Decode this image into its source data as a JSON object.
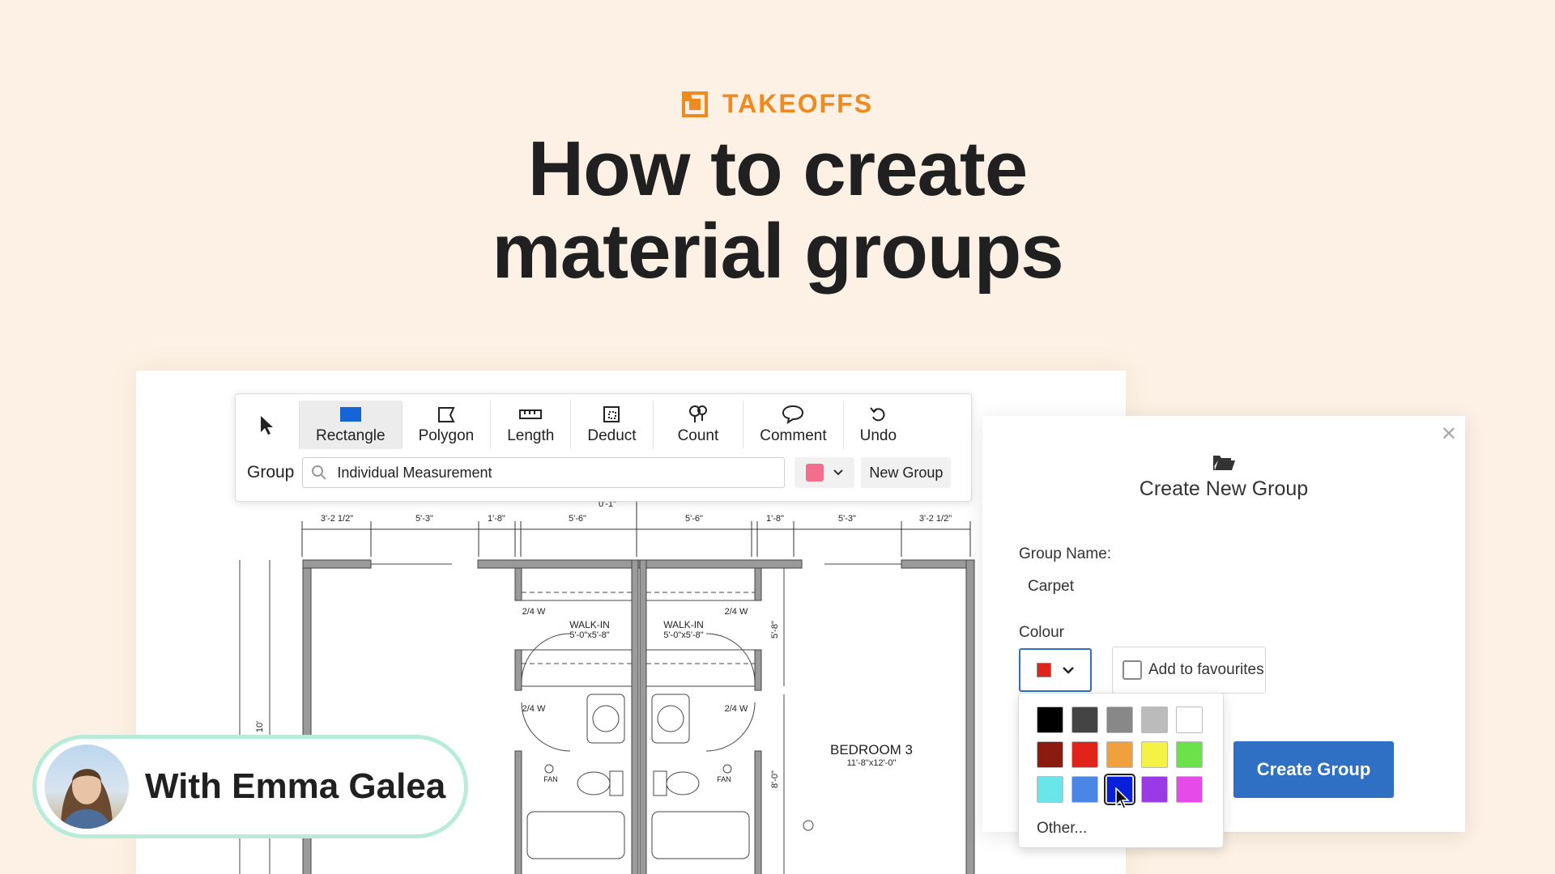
{
  "header": {
    "category": "TAKEOFFS",
    "title_line1": "How to create",
    "title_line2": "material groups",
    "accent_color": "#ee8a1f"
  },
  "toolbar": {
    "tools": [
      {
        "label": "",
        "icon": "cursor-arrow-icon"
      },
      {
        "label": "Rectangle",
        "icon": "rectangle-icon",
        "active": true
      },
      {
        "label": "Polygon",
        "icon": "polygon-icon"
      },
      {
        "label": "Length",
        "icon": "ruler-icon"
      },
      {
        "label": "Deduct",
        "icon": "deduct-icon"
      },
      {
        "label": "Count",
        "icon": "count-pin-icon"
      },
      {
        "label": "Comment",
        "icon": "speech-bubble-icon"
      },
      {
        "label": "Undo",
        "icon": "undo-icon"
      }
    ],
    "group_label": "Group",
    "group_value": "Individual Measurement",
    "group_color": "#f46d8c",
    "new_group_label": "New Group"
  },
  "plan": {
    "dims_top": [
      "3'-2 1/2\"",
      "5'-3\"",
      "1'-8\"",
      "5'-6\"",
      "5'-6\"",
      "1'-8\"",
      "5'-3\"",
      "3'-2 1/2\""
    ],
    "dim_center": "0'-1\"",
    "room_name": "BEDROOM 3",
    "room_size": "11'-8\"x12'-0\"",
    "walkin_label": "WALK-IN",
    "walkin_size": "5'-0\"x5'-8\"",
    "door_label": "2/4 W",
    "fan_label": "FAN",
    "vert_dim_1": "5'-8\"",
    "vert_dim_2": "8'-0\"",
    "vert_dim_left": "10'"
  },
  "dialog": {
    "title": "Create New Group",
    "group_name_label": "Group Name:",
    "group_name_value": "Carpet",
    "colour_label": "Colour",
    "selected_colour": "#e0241b",
    "favourites_label": "Add to favourites",
    "create_button": "Create Group",
    "primary_color": "#2f6fc4"
  },
  "palette": {
    "colors": [
      "#000000",
      "#444444",
      "#888888",
      "#bbbbbb",
      "#ffffff",
      "#8b1a10",
      "#e0241b",
      "#f0a03c",
      "#f5f246",
      "#6be24a",
      "#6ae6ea",
      "#4a86e6",
      "#0a1fd8",
      "#9a3ae6",
      "#e64ae8"
    ],
    "selected_index": 12,
    "other_label": "Other..."
  },
  "presenter": {
    "label": "With Emma Galea"
  }
}
